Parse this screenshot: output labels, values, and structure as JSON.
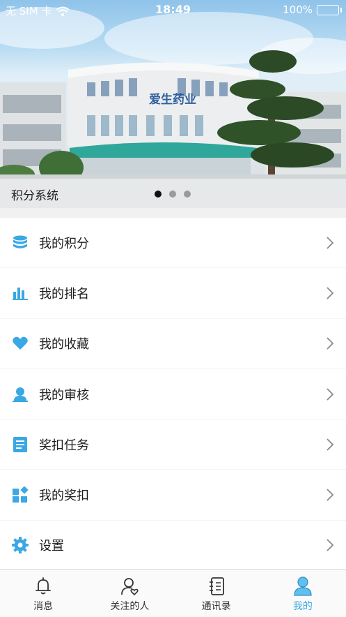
{
  "status_bar": {
    "carrier": "无 SIM 卡",
    "time": "18:49",
    "battery": "100%"
  },
  "banner": {
    "building_sign": "爱生药业",
    "caption": "积分系统",
    "slides_total": 3,
    "active_slide": 1
  },
  "menu": {
    "items": [
      {
        "label": "我的积分",
        "icon": "database-icon"
      },
      {
        "label": "我的排名",
        "icon": "bar-chart-icon"
      },
      {
        "label": "我的收藏",
        "icon": "heart-icon"
      },
      {
        "label": "我的审核",
        "icon": "user-icon"
      },
      {
        "label": "奖扣任务",
        "icon": "document-icon"
      },
      {
        "label": "我的奖扣",
        "icon": "widgets-icon"
      },
      {
        "label": "设置",
        "icon": "gear-icon"
      }
    ]
  },
  "tabbar": {
    "tabs": [
      {
        "label": "消息",
        "icon": "bell-icon",
        "active": false
      },
      {
        "label": "关注的人",
        "icon": "follow-user-icon",
        "active": false
      },
      {
        "label": "通讯录",
        "icon": "contacts-icon",
        "active": false
      },
      {
        "label": "我的",
        "icon": "profile-icon",
        "active": true
      }
    ]
  },
  "colors": {
    "accent": "#3aa8e4",
    "text": "#1e1e1e",
    "inactive": "#333333"
  }
}
